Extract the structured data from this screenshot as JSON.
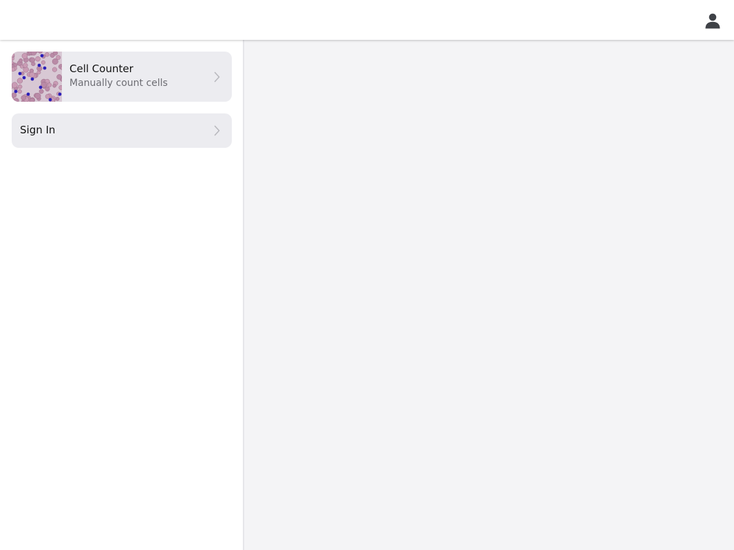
{
  "header": {
    "user_icon": "user-icon"
  },
  "sidebar": {
    "items": [
      {
        "title": "Cell Counter",
        "subtitle": "Manually count cells",
        "thumbnail": "blood-cell-micrograph",
        "chevron_icon": "chevron-right-icon"
      },
      {
        "title": "Sign In",
        "chevron_icon": "chevron-right-icon"
      }
    ]
  },
  "colors": {
    "card_background": "#ececf0",
    "main_background": "#f4f4f6",
    "subtitle_text": "#6d6d73",
    "icon": "#3f4247",
    "chevron": "#b8b8bd",
    "stained_nucleus": "#2b1fb8"
  }
}
